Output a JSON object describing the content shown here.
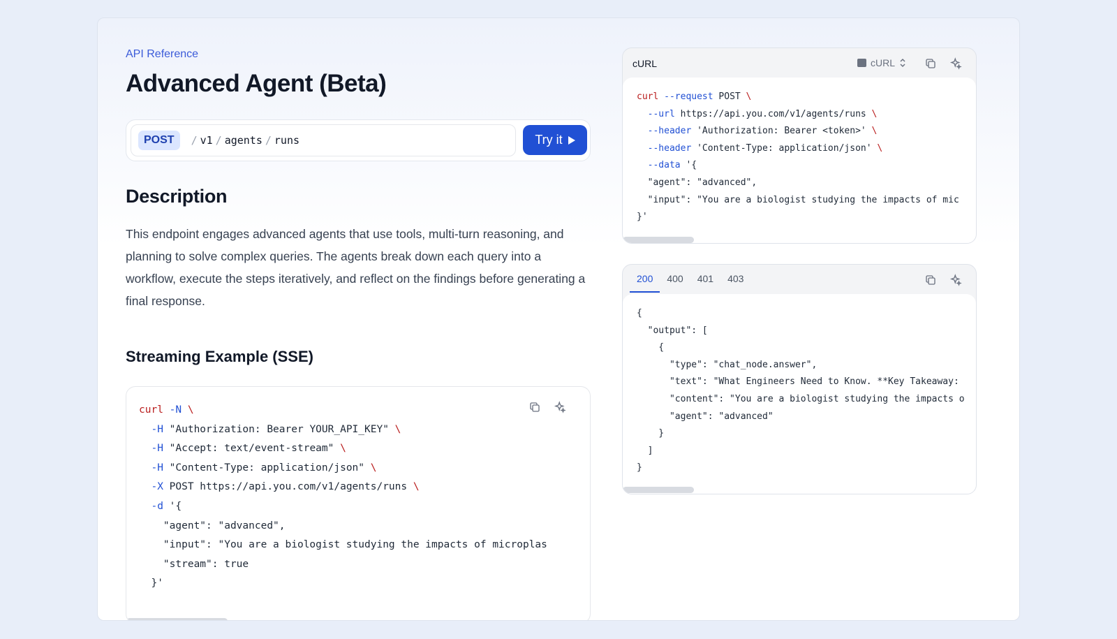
{
  "breadcrumb": "API Reference",
  "title": "Advanced Agent (Beta)",
  "endpoint": {
    "method": "POST",
    "segments": [
      "v1",
      "agents",
      "runs"
    ],
    "try_label": "Try it"
  },
  "description": {
    "heading": "Description",
    "text": "This endpoint engages advanced agents that use tools, multi-turn reasoning, and planning to solve complex queries. The agents break down each query into a workflow, execute the steps iteratively, and reflect on the findings before generating a final response."
  },
  "streaming": {
    "heading": "Streaming Example (SSE)",
    "lines": [
      [
        {
          "t": "curl ",
          "c": "c-red"
        },
        {
          "t": "-N",
          "c": "c-blue"
        },
        {
          "t": " \\",
          "c": "c-red"
        }
      ],
      [
        {
          "t": "  -H ",
          "c": "c-blue"
        },
        {
          "t": "\"Authorization: Bearer YOUR_API_KEY\"",
          "c": "c-str"
        },
        {
          "t": " \\",
          "c": "c-red"
        }
      ],
      [
        {
          "t": "  -H ",
          "c": "c-blue"
        },
        {
          "t": "\"Accept: text/event-stream\"",
          "c": "c-str"
        },
        {
          "t": " \\",
          "c": "c-red"
        }
      ],
      [
        {
          "t": "  -H ",
          "c": "c-blue"
        },
        {
          "t": "\"Content-Type: application/json\"",
          "c": "c-str"
        },
        {
          "t": " \\",
          "c": "c-red"
        }
      ],
      [
        {
          "t": "  -X ",
          "c": "c-blue"
        },
        {
          "t": "POST https://api.you.com/v1/agents/runs",
          "c": "c-str"
        },
        {
          "t": " \\",
          "c": "c-red"
        }
      ],
      [
        {
          "t": "  -d ",
          "c": "c-blue"
        },
        {
          "t": "'{",
          "c": "c-str"
        }
      ],
      [
        {
          "t": "    \"agent\": \"advanced\",",
          "c": "c-str"
        }
      ],
      [
        {
          "t": "    \"input\": \"You are a biologist studying the impacts of microplas",
          "c": "c-str"
        }
      ],
      [
        {
          "t": "    \"stream\": true",
          "c": "c-str"
        }
      ],
      [
        {
          "t": "  }'",
          "c": "c-str"
        }
      ]
    ]
  },
  "request_panel": {
    "title": "cURL",
    "language": "cURL",
    "lines": [
      [
        {
          "t": "curl ",
          "c": "c-red"
        },
        {
          "t": "--request ",
          "c": "c-blue"
        },
        {
          "t": "POST",
          "c": "c-str"
        },
        {
          "t": " \\",
          "c": "c-red"
        }
      ],
      [
        {
          "t": "  --url ",
          "c": "c-blue"
        },
        {
          "t": "https://api.you.com/v1/agents/runs",
          "c": "c-str"
        },
        {
          "t": " \\",
          "c": "c-red"
        }
      ],
      [
        {
          "t": "  --header ",
          "c": "c-blue"
        },
        {
          "t": "'Authorization: Bearer <token>'",
          "c": "c-str"
        },
        {
          "t": " \\",
          "c": "c-red"
        }
      ],
      [
        {
          "t": "  --header ",
          "c": "c-blue"
        },
        {
          "t": "'Content-Type: application/json'",
          "c": "c-str"
        },
        {
          "t": " \\",
          "c": "c-red"
        }
      ],
      [
        {
          "t": "  --data ",
          "c": "c-blue"
        },
        {
          "t": "'{",
          "c": "c-str"
        }
      ],
      [
        {
          "t": "  \"agent\": \"advanced\",",
          "c": "c-str"
        }
      ],
      [
        {
          "t": "  \"input\": \"You are a biologist studying the impacts of mic",
          "c": "c-str"
        }
      ],
      [
        {
          "t": "}'",
          "c": "c-str"
        }
      ]
    ]
  },
  "response_panel": {
    "tabs": [
      "200",
      "400",
      "401",
      "403"
    ],
    "active_tab": "200",
    "lines": [
      [
        {
          "t": "{",
          "c": "c-str"
        }
      ],
      [
        {
          "t": "  \"output\": [",
          "c": "c-str"
        }
      ],
      [
        {
          "t": "    {",
          "c": "c-str"
        }
      ],
      [
        {
          "t": "      \"type\": \"chat_node.answer\",",
          "c": "c-str"
        }
      ],
      [
        {
          "t": "      \"text\": \"What Engineers Need to Know. **Key Takeaway:",
          "c": "c-str"
        }
      ],
      [
        {
          "t": "      \"content\": \"You are a biologist studying the impacts o",
          "c": "c-str"
        }
      ],
      [
        {
          "t": "      \"agent\": \"advanced\"",
          "c": "c-str"
        }
      ],
      [
        {
          "t": "    }",
          "c": "c-str"
        }
      ],
      [
        {
          "t": "  ]",
          "c": "c-str"
        }
      ],
      [
        {
          "t": "}",
          "c": "c-str"
        }
      ]
    ]
  },
  "icons": {
    "copy": "copy-icon",
    "ask_ai": "sparkle-icon",
    "chevron": "chevron-up-down-icon",
    "terminal": "terminal-icon",
    "play": "play-icon"
  },
  "colors": {
    "accent": "#2150d4",
    "keyword_red": "#b91c1c",
    "flag_blue": "#2150d4",
    "background": "#e8eef9"
  }
}
